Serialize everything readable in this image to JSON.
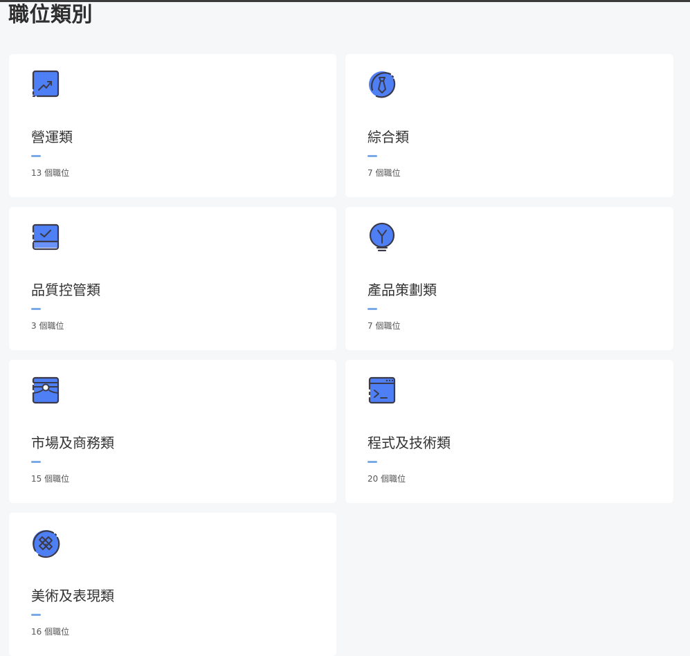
{
  "page": {
    "title": "職位類別"
  },
  "colors": {
    "background": "#f6f7f9",
    "card": "#ffffff",
    "accent": "#7aa9e8",
    "icon_fill": "#4f7ff5",
    "icon_stroke": "#3a3a4a"
  },
  "categories": [
    {
      "name": "營運類",
      "count": "13 個職位",
      "icon": "trend-chart-icon"
    },
    {
      "name": "綜合類",
      "count": "7 個職位",
      "icon": "necktie-icon"
    },
    {
      "name": "品質控管類",
      "count": "3 個職位",
      "icon": "checkbox-tray-icon"
    },
    {
      "name": "產品策劃類",
      "count": "7 個職位",
      "icon": "lightbulb-icon"
    },
    {
      "name": "市場及商務類",
      "count": "15 個職位",
      "icon": "briefcase-icon"
    },
    {
      "name": "程式及技術類",
      "count": "20 個職位",
      "icon": "terminal-icon"
    },
    {
      "name": "美術及表現類",
      "count": "16 個職位",
      "icon": "pencil-ruler-icon"
    }
  ]
}
